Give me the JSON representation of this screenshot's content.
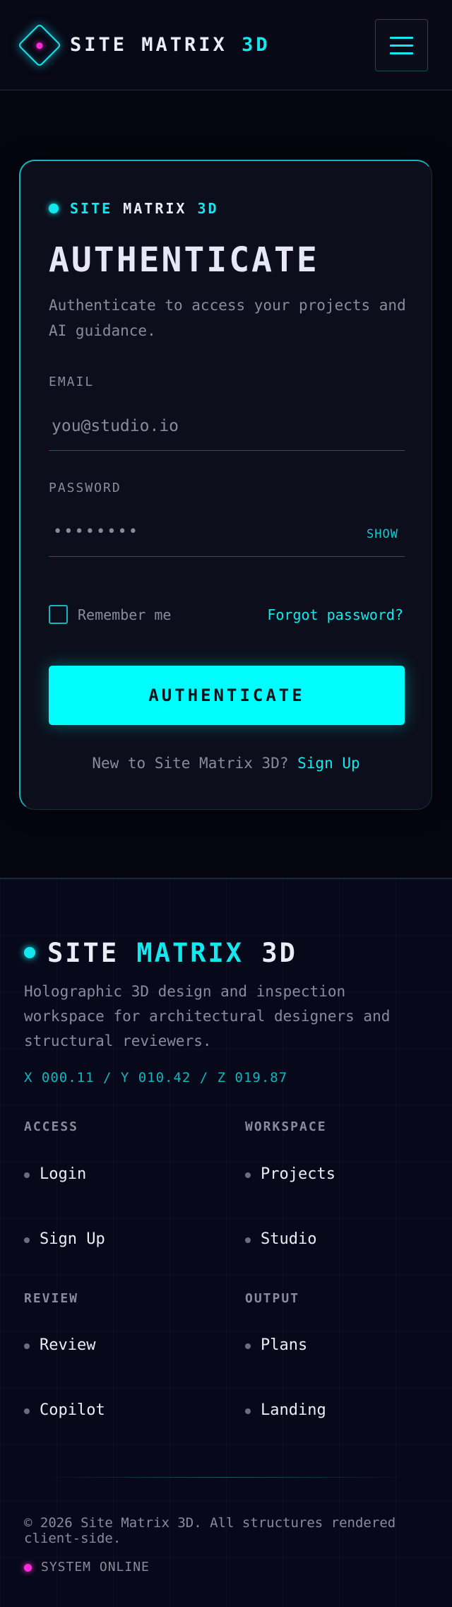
{
  "header": {
    "brand_main": "SITE MATRIX",
    "brand_accent": "3D"
  },
  "auth_card": {
    "brand_part1": "SITE",
    "brand_part2": "MATRIX",
    "brand_part3": "3D",
    "title": "AUTHENTICATE",
    "subtitle": "Authenticate to access your projects and AI guidance.",
    "email_label": "EMAIL",
    "email_placeholder": "you@studio.io",
    "password_label": "PASSWORD",
    "password_mask": "••••••••",
    "show_label": "SHOW",
    "remember_label": "Remember me",
    "forgot_label": "Forgot password?",
    "submit_label": "AUTHENTICATE",
    "signup_prompt": "New to Site Matrix 3D?",
    "signup_link": "Sign Up"
  },
  "footer": {
    "title_part1": "SITE",
    "title_part2": "MATRIX",
    "title_part3": "3D",
    "description": "Holographic 3D design and inspection workspace for architectural designers and structural reviewers.",
    "coords": "X 000.11 / Y 010.42 / Z 019.87",
    "columns": [
      {
        "heading": "ACCESS",
        "links": [
          "Login",
          "Sign Up"
        ]
      },
      {
        "heading": "WORKSPACE",
        "links": [
          "Projects",
          "Studio"
        ]
      },
      {
        "heading": "REVIEW",
        "links": [
          "Review",
          "Copilot"
        ]
      },
      {
        "heading": "OUTPUT",
        "links": [
          "Plans",
          "Landing"
        ]
      }
    ],
    "copyright": "© 2026 Site Matrix 3D. All structures rendered client-side.",
    "status": "SYSTEM ONLINE"
  },
  "colors": {
    "accent": "#12e8ee",
    "magenta": "#ff2bd6",
    "button": "#00fdfd",
    "background": "#05050f"
  }
}
